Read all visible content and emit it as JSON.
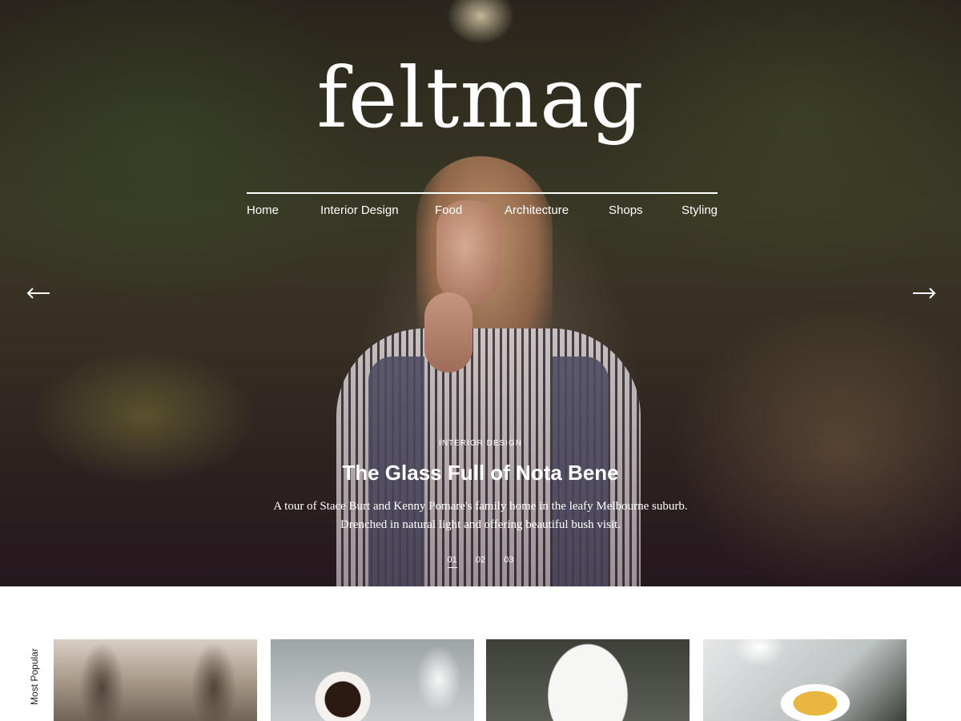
{
  "brand": {
    "logo": "feltmag"
  },
  "nav": {
    "items": [
      {
        "label": "Home"
      },
      {
        "label": "Interior Design"
      },
      {
        "label": "Food"
      },
      {
        "label": "Architecture"
      },
      {
        "label": "Shops"
      },
      {
        "label": "Styling"
      }
    ]
  },
  "slider": {
    "prev_icon": "arrow-left-icon",
    "next_icon": "arrow-right-icon",
    "category": "INTERIOR DESIGN",
    "title": "The Glass Full of Nota Bene",
    "description": "A tour of Stace Burt and Kenny Pomare's family home in the leafy Melbourne suburb. Drenched in natural light and offering beautiful bush visit.",
    "pages": [
      "01",
      "02",
      "03"
    ],
    "active_page": "01"
  },
  "popular": {
    "label": "Most Popular",
    "cards": [
      {
        "image": "tree-lined-road"
      },
      {
        "image": "coffee-cup-flowers"
      },
      {
        "image": "man-with-phone"
      },
      {
        "image": "tea-pouring"
      }
    ]
  },
  "colors": {
    "text_on_hero": "#ffffff",
    "page_bg": "#ffffff",
    "label_text": "#222222"
  }
}
